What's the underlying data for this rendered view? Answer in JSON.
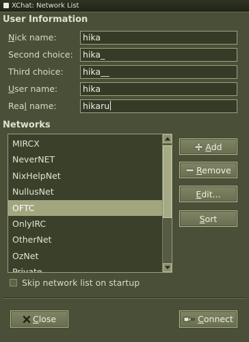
{
  "window": {
    "title": "XChat: Network List"
  },
  "user_info": {
    "heading": "User Information",
    "fields": [
      {
        "label": "Nick name:",
        "value": "hika"
      },
      {
        "label": "Second choice:",
        "value": "hika_"
      },
      {
        "label": "Third choice:",
        "value": "hika__"
      },
      {
        "label": "User name:",
        "value": "hika"
      },
      {
        "label": "Real name:",
        "value": "hikaru"
      }
    ]
  },
  "networks": {
    "heading": "Networks",
    "items": [
      "MIRCX",
      "NeverNET",
      "NixHelpNet",
      "NullusNet",
      "OFTC",
      "OnlyIRC",
      "OtherNet",
      "OzNet",
      "Private"
    ],
    "selected": "OFTC"
  },
  "buttons": {
    "add": "Add",
    "remove": "Remove",
    "edit": "Edit...",
    "sort": "Sort",
    "close": "Close",
    "connect": "Connect"
  },
  "skip_option": {
    "label": "Skip network list on startup",
    "checked": false
  }
}
